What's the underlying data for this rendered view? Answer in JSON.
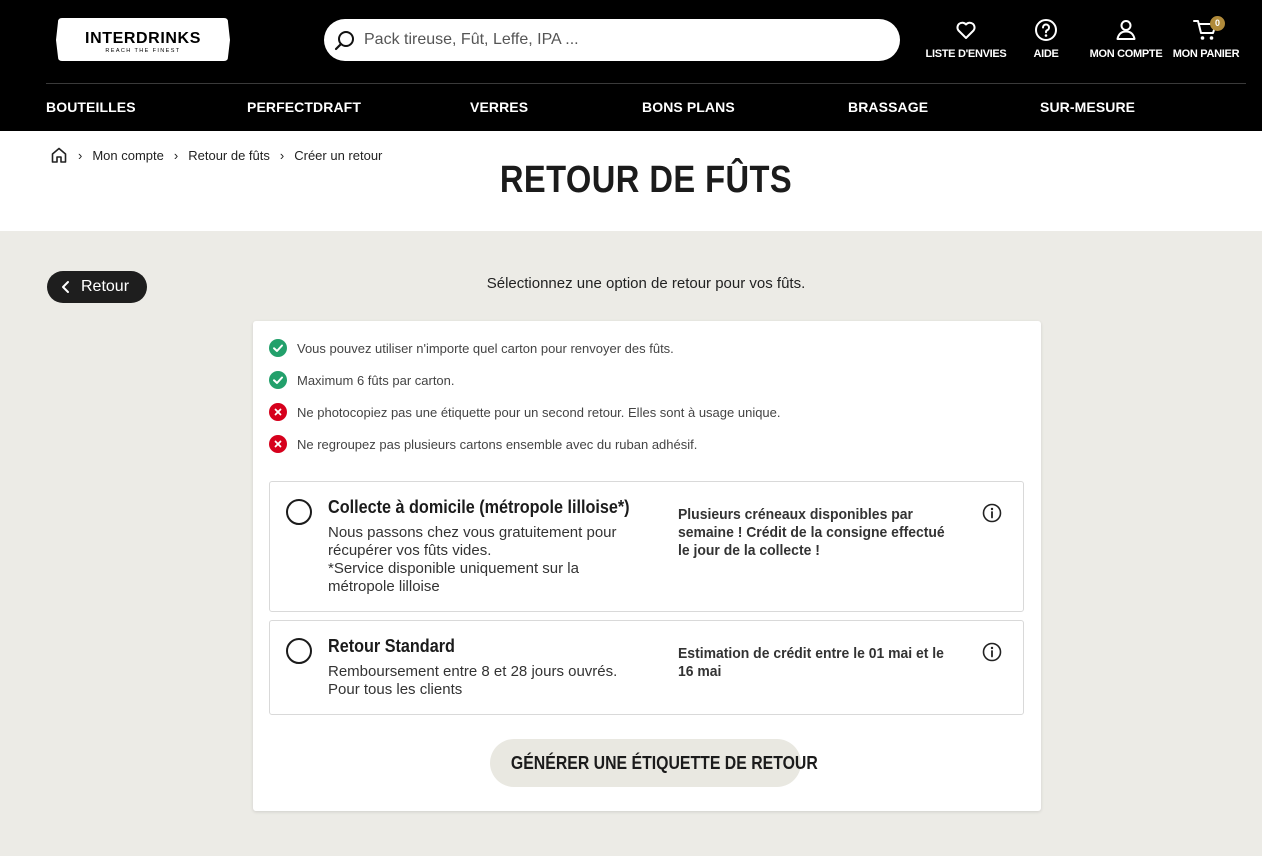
{
  "header": {
    "logo_text": "INTERDRINKS",
    "logo_tagline": "REACH THE FINEST",
    "search_placeholder": "Pack tireuse, Fût, Leffe, IPA ...",
    "actions": {
      "wishlist": "LISTE D'ENVIES",
      "help": "AIDE",
      "account": "MON COMPTE",
      "cart": "MON PANIER",
      "cart_count": "0"
    },
    "nav": [
      "BOUTEILLES",
      "PERFECTDRAFT",
      "VERRES",
      "BONS PLANS",
      "BRASSAGE",
      "SUR-MESURE"
    ]
  },
  "breadcrumb": [
    "Mon compte",
    "Retour de fûts",
    "Créer un retour"
  ],
  "page_title": "RETOUR DE FÛTS",
  "back_label": "Retour",
  "intro": "Sélectionnez une option de retour pour vos fûts.",
  "rules": [
    {
      "type": "ok",
      "text": "Vous pouvez utiliser n'importe quel carton pour renvoyer des fûts."
    },
    {
      "type": "ok",
      "text": "Maximum 6 fûts par carton."
    },
    {
      "type": "no",
      "text": "Ne photocopiez pas une étiquette pour un second retour. Elles sont à usage unique."
    },
    {
      "type": "no",
      "text": "Ne regroupez pas plusieurs cartons ensemble avec du ruban adhésif."
    }
  ],
  "options": [
    {
      "title": "Collecte à domicile (métropole lilloise*)",
      "description": "Nous passons chez vous gratuitement pour récupérer vos fûts vides.",
      "footnote": "*Service disponible uniquement sur la métropole lilloise",
      "note": "Plusieurs créneaux disponibles par semaine ! Crédit de la consigne effectué le jour de la collecte !",
      "selected": false
    },
    {
      "title": "Retour Standard",
      "description": "Remboursement entre 8 et 28 jours ouvrés.",
      "footnote": "Pour tous les clients",
      "note": "Estimation de crédit entre le 01 mai et le 16 mai",
      "selected": false
    }
  ],
  "generate_label": "GÉNÉRER UNE ÉTIQUETTE DE RETOUR",
  "colors": {
    "header_bg": "#000000",
    "page_bg": "#ecebe6",
    "ok": "#22a06b",
    "no": "#d6001c",
    "cart_badge": "#b08a3a"
  }
}
